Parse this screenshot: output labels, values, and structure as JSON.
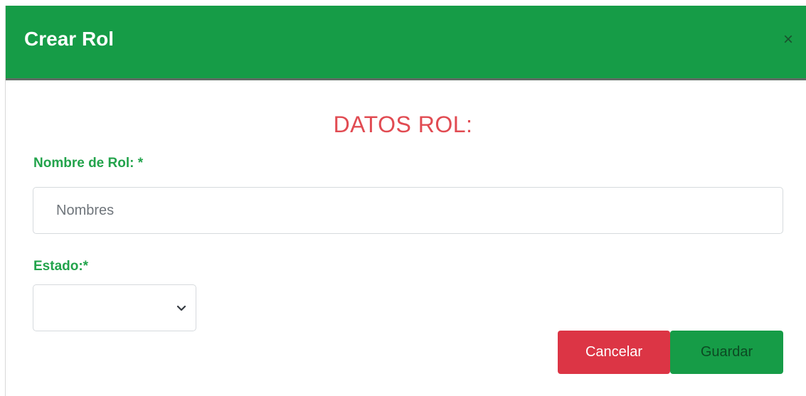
{
  "modal": {
    "title": "Crear Rol",
    "close_symbol": "×",
    "close_icon": "close-icon"
  },
  "form": {
    "section_title": "DATOS ROL:",
    "nombre_label": "Nombre de Rol: *",
    "nombre_placeholder": "Nombres",
    "nombre_value": "",
    "estado_label": "Estado:*",
    "estado_selected": "",
    "estado_icon": "chevron-down-icon"
  },
  "buttons": {
    "cancel_label": "Cancelar",
    "save_label": "Guardar"
  },
  "colors": {
    "header": "#169c47",
    "section_title": "#e14b52",
    "label": "#22a34b",
    "cancel": "#dc3545",
    "save": "#169c47"
  }
}
